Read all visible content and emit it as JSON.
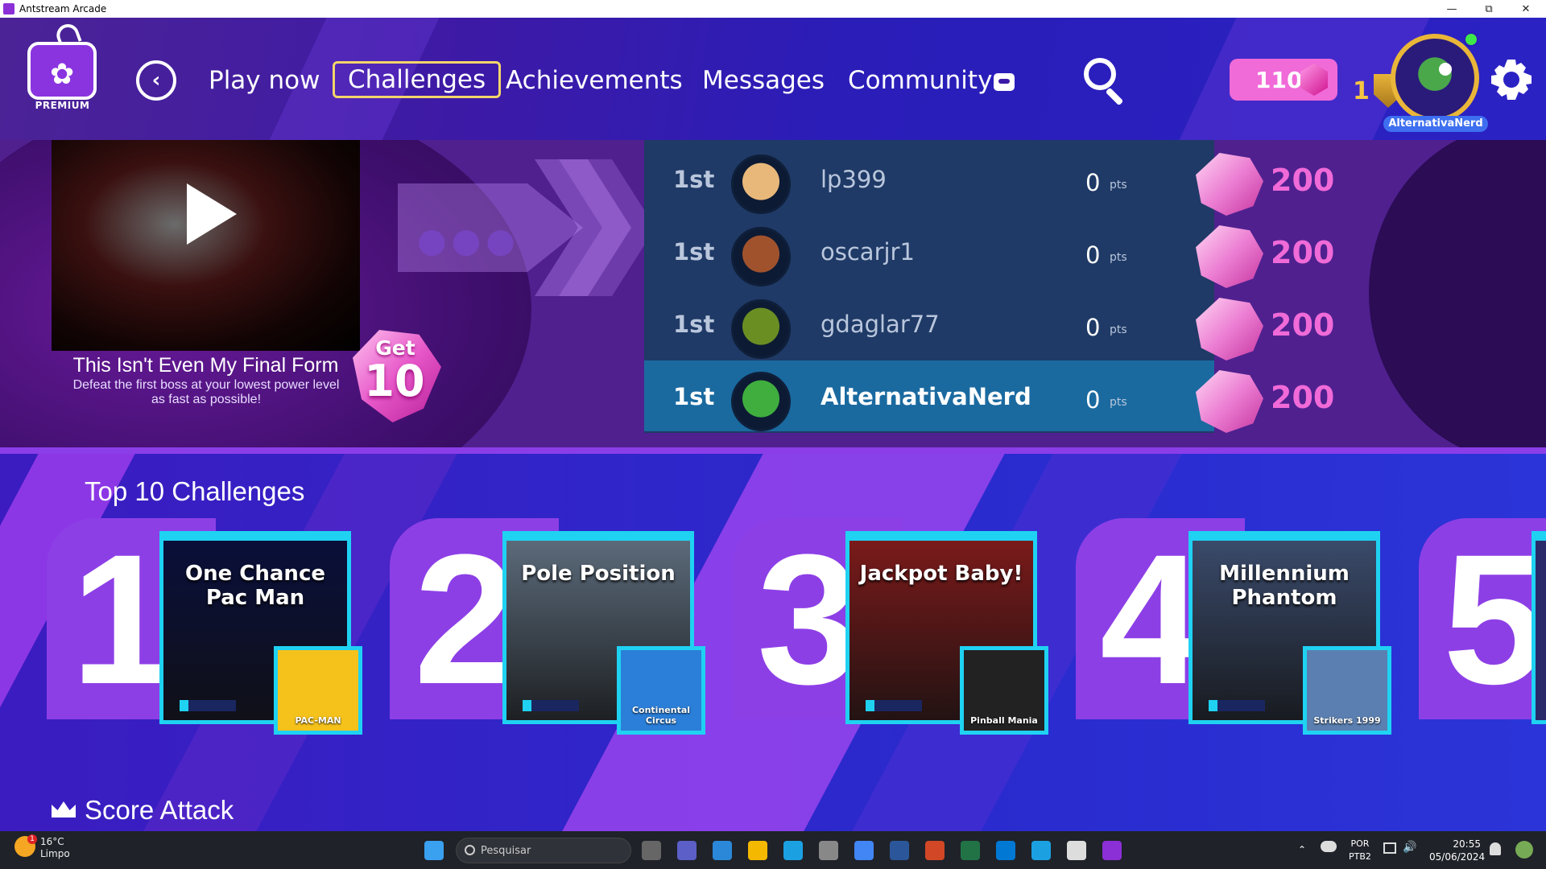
{
  "window": {
    "title": "Antstream Arcade",
    "controls": [
      "minimize",
      "restore",
      "close"
    ]
  },
  "header": {
    "logo_badge": "PREMIUM",
    "nav": [
      "Play now",
      "Challenges",
      "Achievements",
      "Messages",
      "Community"
    ],
    "active_nav": "Challenges",
    "gems": "110",
    "level": "1",
    "username": "AlternativaNerd"
  },
  "feature": {
    "challenge_title": "This Isn't Even My Final Form",
    "challenge_desc": "Defeat the first boss at your lowest power level as fast as possible!",
    "reward_label": "Get",
    "reward_value": "10"
  },
  "leaderboard": [
    {
      "rank": "1st",
      "name": "lp399",
      "score": "0",
      "unit": "pts",
      "reward": "200",
      "avatar_color": "#e8b87a"
    },
    {
      "rank": "1st",
      "name": "oscarjr1",
      "score": "0",
      "unit": "pts",
      "reward": "200",
      "avatar_color": "#a0522d"
    },
    {
      "rank": "1st",
      "name": "gdaglar77",
      "score": "0",
      "unit": "pts",
      "reward": "200",
      "avatar_color": "#6b8e23"
    },
    {
      "rank": "1st",
      "name": "AlternativaNerd",
      "score": "0",
      "unit": "pts",
      "reward": "200",
      "avatar_color": "#3fae3f",
      "current_user": true
    }
  ],
  "top10": {
    "title": "Top 10 Challenges",
    "items": [
      {
        "number": "1",
        "title": "One Chance Pac Man",
        "game": "PAC-MAN",
        "bg": "#0a0f3a",
        "thumb_bg": "#f5c21b",
        "progress": 0.15
      },
      {
        "number": "2",
        "title": "Pole Position",
        "game": "Continental Circus",
        "bg": "#5b6a7a",
        "thumb_bg": "#2b7fd8",
        "progress": 0.15
      },
      {
        "number": "3",
        "title": "Jackpot Baby!",
        "game": "Pinball Mania",
        "bg": "#7a1a1a",
        "thumb_bg": "#222222",
        "progress": 0.15
      },
      {
        "number": "4",
        "title": "Millennium Phantom",
        "game": "Strikers 1999",
        "bg": "#3a4a6a",
        "thumb_bg": "#5a7fb0",
        "progress": 0.15
      },
      {
        "number": "5",
        "title": "",
        "game": "",
        "bg": "#2a2a6a",
        "thumb_bg": "#2a2a6a",
        "progress": 0
      }
    ]
  },
  "score_attack": {
    "title": "Score Attack"
  },
  "taskbar": {
    "weather_temp": "16°C",
    "weather_desc": "Limpo",
    "search_placeholder": "Pesquisar",
    "lang1": "POR",
    "lang2": "PTB2",
    "time": "20:55",
    "date": "05/06/2024",
    "weather_badge": "1",
    "apps": [
      "start",
      "task-view",
      "teams",
      "store",
      "explorer",
      "edge",
      "unknown",
      "chrome",
      "word",
      "powerpoint",
      "excel",
      "outlook",
      "ccleaner",
      "capcut",
      "antstream"
    ]
  }
}
